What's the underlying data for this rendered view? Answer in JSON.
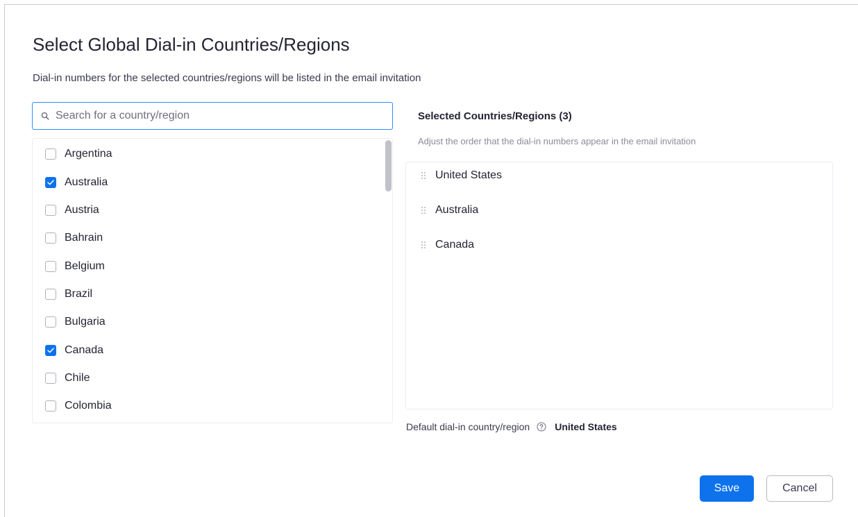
{
  "dialog": {
    "title": "Select Global Dial-in Countries/Regions",
    "subtitle": "Dial-in numbers for the selected countries/regions will be listed in the email invitation"
  },
  "search": {
    "placeholder": "Search for a country/region",
    "value": "",
    "icon": "search-icon"
  },
  "countries": [
    {
      "label": "Argentina",
      "checked": false
    },
    {
      "label": "Australia",
      "checked": true
    },
    {
      "label": "Austria",
      "checked": false
    },
    {
      "label": "Bahrain",
      "checked": false
    },
    {
      "label": "Belgium",
      "checked": false
    },
    {
      "label": "Brazil",
      "checked": false
    },
    {
      "label": "Bulgaria",
      "checked": false
    },
    {
      "label": "Canada",
      "checked": true
    },
    {
      "label": "Chile",
      "checked": false
    },
    {
      "label": "Colombia",
      "checked": false
    }
  ],
  "selected": {
    "heading": "Selected Countries/Regions (3)",
    "hint": "Adjust the order that the dial-in numbers appear in the email invitation",
    "items": [
      "United States",
      "Australia",
      "Canada"
    ]
  },
  "default_region": {
    "label": "Default dial-in country/region",
    "value": "United States"
  },
  "buttons": {
    "save": "Save",
    "cancel": "Cancel"
  },
  "colors": {
    "accent": "#0e72ed",
    "focus_border": "#2d8cff"
  }
}
